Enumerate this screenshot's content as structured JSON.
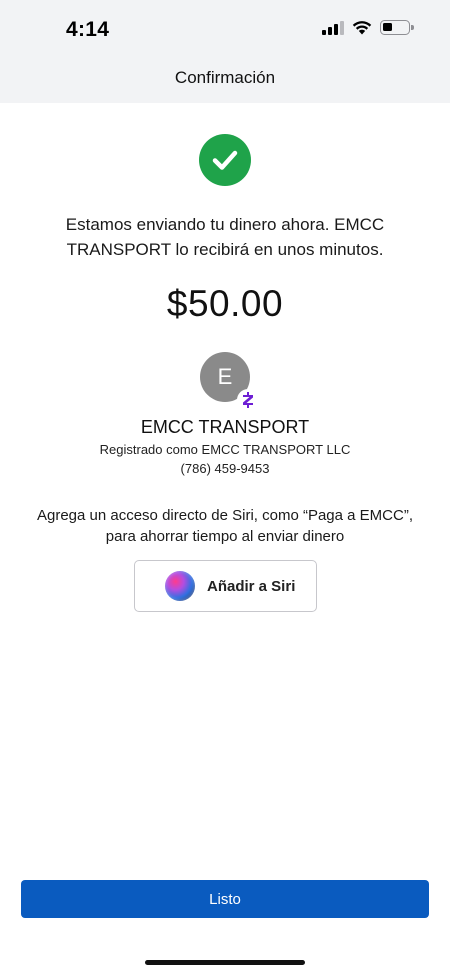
{
  "status_bar": {
    "time": "4:14",
    "icons": [
      "cellular-signal-icon",
      "wifi-icon",
      "battery-icon"
    ]
  },
  "nav": {
    "title": "Confirmación"
  },
  "confirmation": {
    "status_icon": "check-circle-icon",
    "status_color": "#1fa34a",
    "message": "Estamos enviando tu dinero ahora. EMCC TRANSPORT lo recibirá en unos minutos.",
    "amount": "$50.00"
  },
  "recipient": {
    "avatar_initial": "E",
    "badge_icon": "zelle-icon",
    "name": "EMCC TRANSPORT",
    "registered_as": "Registrado como EMCC TRANSPORT LLC",
    "phone": "(786) 459-9453"
  },
  "siri": {
    "prompt": "Agrega un acceso directo de Siri, como “Paga a EMCC”, para ahorrar tiempo al enviar dinero",
    "button_label": "Añadir a Siri",
    "button_icon": "siri-icon"
  },
  "footer": {
    "done_label": "Listo",
    "accent_color": "#0a5bbf"
  }
}
